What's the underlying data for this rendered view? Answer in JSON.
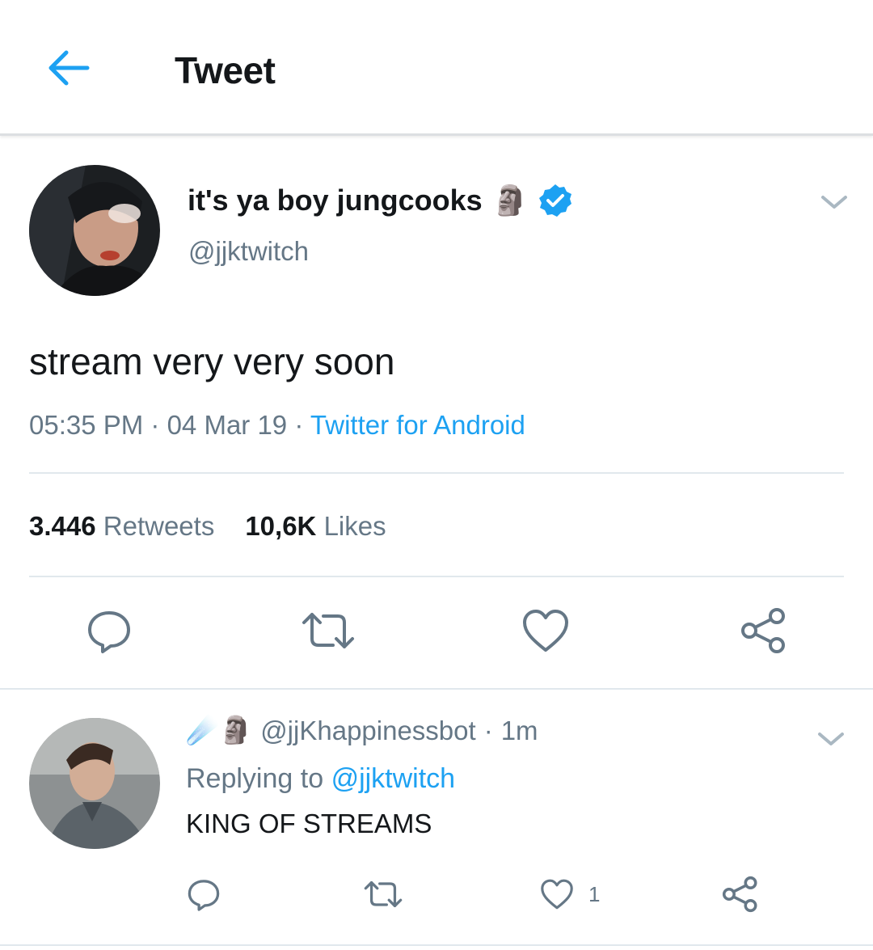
{
  "header": {
    "title": "Tweet",
    "back_icon": "arrow-left-icon",
    "accent_color": "#1da1f2"
  },
  "tweet": {
    "display_name": "it's ya boy jungcooks",
    "name_emoji": "🗿",
    "verified_icon": "verified-badge-icon",
    "handle": "@jjktwitch",
    "text": "stream very very soon",
    "time": "05:35 PM",
    "date": "04 Mar 19",
    "separator": " · ",
    "source": "Twitter for Android",
    "retweets_count": "3.446",
    "retweets_label": "Retweets",
    "likes_count": "10,6K",
    "likes_label": "Likes",
    "actions": [
      "reply-icon",
      "retweet-icon",
      "like-icon",
      "share-icon"
    ]
  },
  "reply": {
    "emojis": "☄️🗿",
    "handle": "@jjKhappinessbot",
    "time": "1m",
    "separator": " · ",
    "replying_label": "Replying to",
    "replying_to": "@jjktwitch",
    "text": "KING OF STREAMS",
    "like_count": "1"
  }
}
